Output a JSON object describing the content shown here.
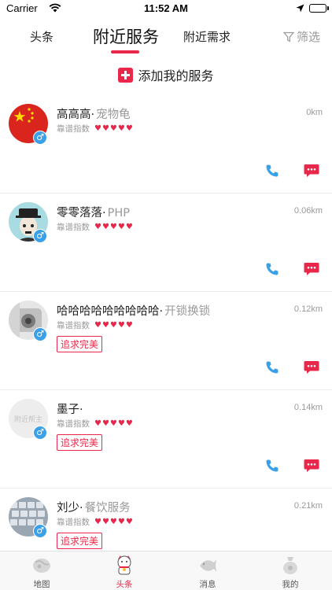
{
  "status_bar": {
    "carrier": "Carrier",
    "time": "11:52 AM"
  },
  "tabs": [
    {
      "label": "头条"
    },
    {
      "label": "附近服务"
    },
    {
      "label": "附近需求"
    }
  ],
  "filter": {
    "label": "筛选",
    "icon": "filter-icon"
  },
  "add_service": {
    "label": "添加我的服务",
    "icon": "plus-icon",
    "color": "#e8274a"
  },
  "rating_label": "靠谱指数",
  "pursue_label": "追求完美",
  "hearts": "♥♥♥♥♥",
  "gender_symbol": "♂",
  "providers": [
    {
      "name": "高高高·",
      "category": "宠物龟",
      "distance": "0km",
      "rating": 5,
      "avatar": "china-flag"
    },
    {
      "name": "零零落落·",
      "category": "PHP",
      "distance": "0.06km",
      "rating": 5,
      "avatar": "cartoon-portrait"
    },
    {
      "name": "哈哈哈哈哈哈哈哈哈·",
      "category": "开锁换锁",
      "distance": "0.12km",
      "rating": 5,
      "avatar": "lock-photo"
    },
    {
      "name": "墨子·",
      "category": "",
      "distance": "0.14km",
      "rating": 5,
      "avatar": "placeholder",
      "avatar_text": "附近帮主"
    },
    {
      "name": "刘少·",
      "category": "餐饮服务",
      "distance": "0.21km",
      "rating": 5,
      "avatar": "keyboard-photo"
    }
  ],
  "bottom_nav": [
    {
      "label": "地图",
      "icon": "map-icon"
    },
    {
      "label": "头条",
      "icon": "lucky-cat-icon",
      "active": true
    },
    {
      "label": "消息",
      "icon": "fish-icon"
    },
    {
      "label": "我的",
      "icon": "money-bag-icon"
    }
  ],
  "colors": {
    "accent": "#e8274a",
    "gender_blue": "#3aa0e8",
    "call_blue": "#3aa0e8"
  }
}
